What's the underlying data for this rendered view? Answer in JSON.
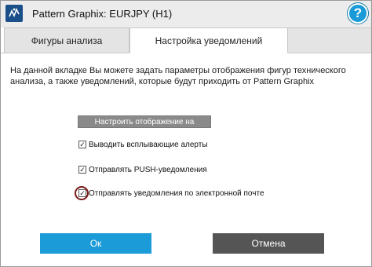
{
  "window": {
    "title": "Pattern Graphix: EURJPY (H1)",
    "app_icon": "pattern-graphix-logo",
    "help_label": "?"
  },
  "tabs": [
    {
      "label": "Фигуры анализа",
      "active": false
    },
    {
      "label": "Настройка уведомлений",
      "active": true
    }
  ],
  "content": {
    "description": "На данной вкладке Вы можете задать параметры отображения фигур технического анализа, а также уведомлений, которые будут приходить от Pattern Graphix",
    "config_button": "Настроить отображение на графике...",
    "checkboxes": [
      {
        "label": "Выводить всплывающие алерты",
        "checked": true
      },
      {
        "label": "Отправлять PUSH-уведомления",
        "checked": true
      },
      {
        "label": "Отправлять уведомления по электронной почте",
        "checked": true
      }
    ]
  },
  "footer": {
    "ok_label": "Ок",
    "cancel_label": "Отмена"
  },
  "colors": {
    "ok_button": "#1b9bd7",
    "cancel_button": "#555555",
    "help_icon": "#1a9ad6",
    "highlight_ring": "#7a1a1a"
  }
}
